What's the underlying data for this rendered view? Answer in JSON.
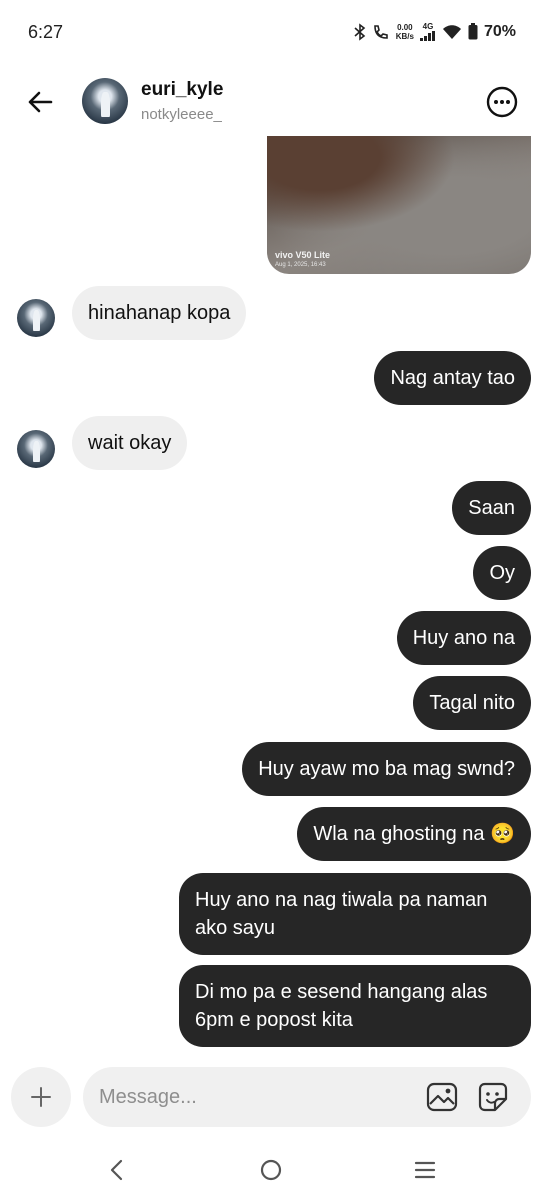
{
  "status_bar": {
    "time": "6:27",
    "net_speed_value": "0.00",
    "net_speed_unit": "KB/s",
    "network_type": "4G",
    "battery": "70%"
  },
  "header": {
    "name": "euri_kyle",
    "handle": "notkyleeee_"
  },
  "photo": {
    "stamp": "vivo V50 Lite",
    "date": "Aug 1, 2025, 16:43"
  },
  "messages": [
    {
      "dir": "in",
      "text": "hinahanap kopa"
    },
    {
      "dir": "out",
      "text": "Nag antay tao"
    },
    {
      "dir": "in",
      "text": "wait okay"
    },
    {
      "dir": "out",
      "text": "Saan"
    },
    {
      "dir": "out",
      "text": "Oy"
    },
    {
      "dir": "out",
      "text": "Huy ano na"
    },
    {
      "dir": "out",
      "text": "Tagal nito"
    },
    {
      "dir": "out",
      "text": "Huy ayaw mo ba mag swnd?"
    },
    {
      "dir": "out",
      "text": "Wla na ghosting na 🥺"
    },
    {
      "dir": "out",
      "text": "Huy ano na nag tiwala pa naman ako sayu"
    },
    {
      "dir": "out",
      "text": "Di mo pa e sesend hangang alas 6pm e popost kita"
    }
  ],
  "composer": {
    "placeholder": "Message..."
  },
  "icons": {
    "back": "arrow-left-icon",
    "more": "more-circle-icon",
    "plus": "plus-icon",
    "gallery": "gallery-icon",
    "sticker": "sticker-icon"
  }
}
